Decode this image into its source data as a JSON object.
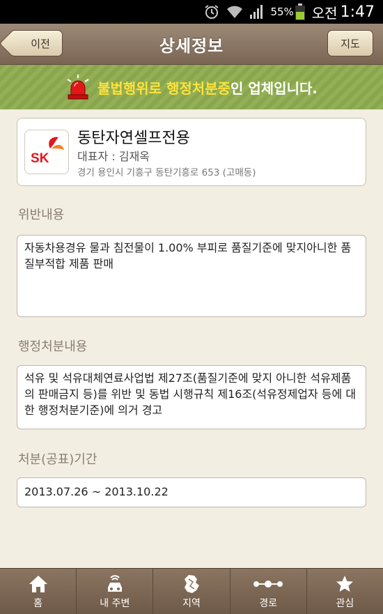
{
  "status_bar": {
    "battery": "55%",
    "ampm": "오전",
    "time": "1:47"
  },
  "header": {
    "back_label": "이전",
    "title": "상세정보",
    "map_label": "지도"
  },
  "banner": {
    "highlight": "불법행위로 행정처분중",
    "suffix": "인 업체입니다."
  },
  "company": {
    "logo_text": "SK",
    "name": "동탄자연셀프전용",
    "representative": "대표자 : 김재옥",
    "address": "경기 용인시 기흥구 동탄기흥로 653 (고매동)"
  },
  "sections": {
    "violation_label": "위반내용",
    "violation_text": "자동차용경유 물과 침전물이 1.00% 부피로 품질기준에 맞지아니한 품질부적합 제품 판매",
    "disposition_label": "행정처분내용",
    "disposition_text": "석유 및 석유대체연료사업법 제27조(품질기준에 맞지 아니한 석유제품의 판매금지 등)를 위반 및 동법 시행규칙 제16조(석유정제업자 등에 대한 행정처분기준)에 의거 경고",
    "period_label": "처분(공표)기간",
    "period_text": "2013.07.26 ~ 2013.10.22"
  },
  "bottom_nav": {
    "home": "홈",
    "nearby": "내 주변",
    "region": "지역",
    "route": "경로",
    "favorites": "관심"
  }
}
